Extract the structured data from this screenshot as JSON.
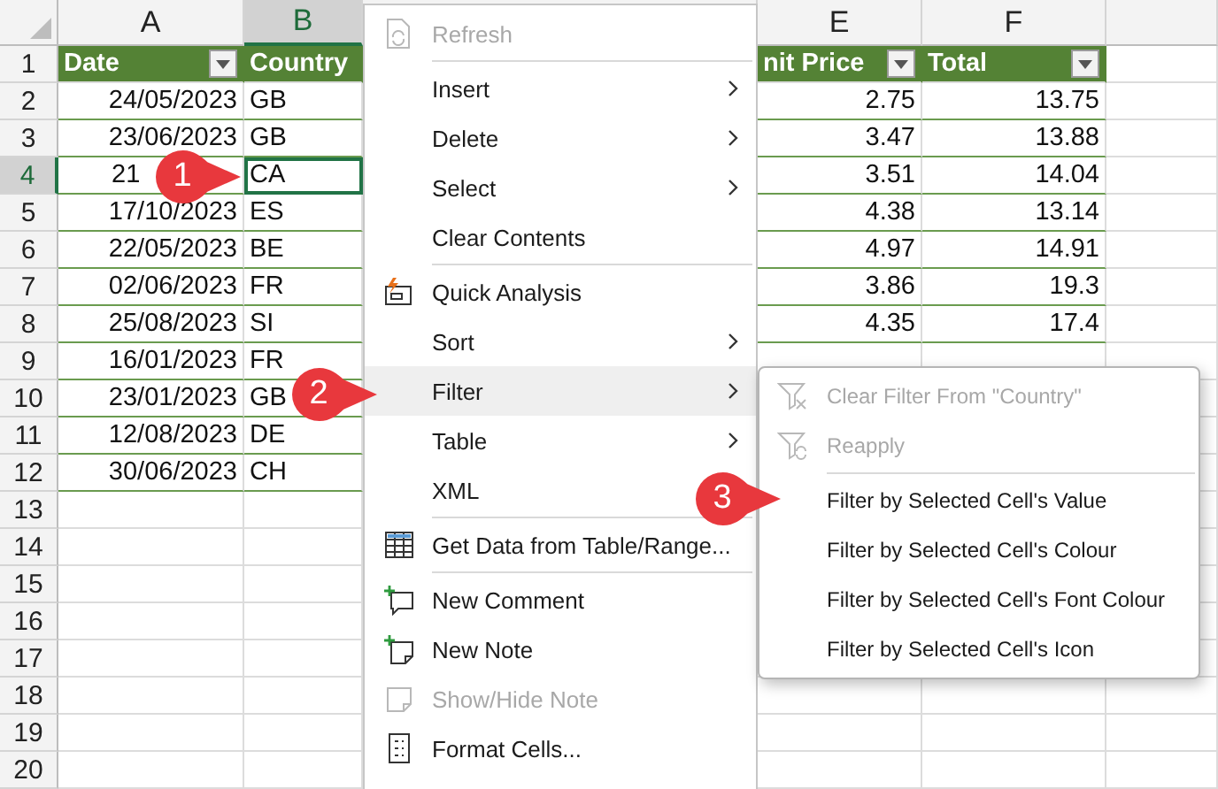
{
  "columns": [
    {
      "letter": "A",
      "selected": false
    },
    {
      "letter": "B",
      "selected": true
    },
    {
      "letter": "E",
      "selected": false
    },
    {
      "letter": "F",
      "selected": false
    }
  ],
  "rows": [
    {
      "number": "1",
      "selected": false,
      "kind": "header",
      "cells": [
        {
          "text": "Date",
          "filter_button": true
        },
        {
          "text": "Country",
          "filter_button": false
        },
        {
          "text": "nit Price",
          "filter_button": true
        },
        {
          "text": "Total",
          "filter_button": true
        }
      ]
    },
    {
      "number": "2",
      "selected": false,
      "kind": "data",
      "cells": [
        {
          "text": "24/05/2023",
          "selected": false
        },
        {
          "text": "GB",
          "selected": false
        },
        {
          "text": "2.75",
          "selected": false
        },
        {
          "text": "13.75",
          "selected": false
        }
      ]
    },
    {
      "number": "3",
      "selected": false,
      "kind": "data",
      "cells": [
        {
          "text": "23/06/2023",
          "selected": false
        },
        {
          "text": "GB",
          "selected": false
        },
        {
          "text": "3.47",
          "selected": false
        },
        {
          "text": "13.88",
          "selected": false
        }
      ]
    },
    {
      "number": "4",
      "selected": true,
      "kind": "data",
      "cells": [
        {
          "text": "21",
          "selected": false,
          "cut": true
        },
        {
          "text": "CA",
          "selected": true
        },
        {
          "text": "3.51",
          "selected": false
        },
        {
          "text": "14.04",
          "selected": false
        }
      ]
    },
    {
      "number": "5",
      "selected": false,
      "kind": "data",
      "cells": [
        {
          "text": "17/10/2023",
          "selected": false
        },
        {
          "text": "ES",
          "selected": false
        },
        {
          "text": "4.38",
          "selected": false
        },
        {
          "text": "13.14",
          "selected": false
        }
      ]
    },
    {
      "number": "6",
      "selected": false,
      "kind": "data",
      "cells": [
        {
          "text": "22/05/2023",
          "selected": false
        },
        {
          "text": "BE",
          "selected": false
        },
        {
          "text": "4.97",
          "selected": false
        },
        {
          "text": "14.91",
          "selected": false
        }
      ]
    },
    {
      "number": "7",
      "selected": false,
      "kind": "data",
      "cells": [
        {
          "text": "02/06/2023",
          "selected": false
        },
        {
          "text": "FR",
          "selected": false
        },
        {
          "text": "3.86",
          "selected": false
        },
        {
          "text": "19.3",
          "selected": false
        }
      ]
    },
    {
      "number": "8",
      "selected": false,
      "kind": "data",
      "cells": [
        {
          "text": "25/08/2023",
          "selected": false
        },
        {
          "text": "SI",
          "selected": false
        },
        {
          "text": "4.35",
          "selected": false
        },
        {
          "text": "17.4",
          "selected": false
        }
      ]
    },
    {
      "number": "9",
      "selected": false,
      "kind": "data",
      "cells": [
        {
          "text": "16/01/2023",
          "selected": false
        },
        {
          "text": "FR",
          "selected": false
        }
      ]
    },
    {
      "number": "10",
      "selected": false,
      "kind": "data",
      "cells": [
        {
          "text": "23/01/2023",
          "selected": false
        },
        {
          "text": "GB",
          "selected": false
        }
      ]
    },
    {
      "number": "11",
      "selected": false,
      "kind": "data",
      "cells": [
        {
          "text": "12/08/2023",
          "selected": false
        },
        {
          "text": "DE",
          "selected": false
        }
      ]
    },
    {
      "number": "12",
      "selected": false,
      "kind": "data",
      "cells": [
        {
          "text": "30/06/2023",
          "selected": false
        },
        {
          "text": "CH",
          "selected": false
        }
      ]
    },
    {
      "number": "13",
      "selected": false,
      "kind": "empty"
    },
    {
      "number": "14",
      "selected": false,
      "kind": "empty"
    },
    {
      "number": "15",
      "selected": false,
      "kind": "empty"
    },
    {
      "number": "16",
      "selected": false,
      "kind": "empty"
    },
    {
      "number": "17",
      "selected": false,
      "kind": "empty"
    },
    {
      "number": "18",
      "selected": false,
      "kind": "empty"
    },
    {
      "number": "19",
      "selected": false,
      "kind": "empty"
    },
    {
      "number": "20",
      "selected": false,
      "kind": "empty"
    }
  ],
  "context_menu": {
    "items": [
      {
        "kind": "command",
        "label": "Refresh",
        "disabled": true,
        "selected": false
      },
      {
        "kind": "separator"
      },
      {
        "kind": "command",
        "label": "Insert",
        "disabled": false,
        "selected": false,
        "submenu": true
      },
      {
        "kind": "command",
        "label": "Delete",
        "disabled": false,
        "selected": false,
        "submenu": true
      },
      {
        "kind": "command",
        "label": "Select",
        "disabled": false,
        "selected": false,
        "submenu": true
      },
      {
        "kind": "command",
        "label": "Clear Contents",
        "disabled": false,
        "selected": false
      },
      {
        "kind": "separator"
      },
      {
        "kind": "command",
        "label": "Quick Analysis",
        "disabled": false,
        "selected": false
      },
      {
        "kind": "command",
        "label": "Sort",
        "disabled": false,
        "selected": false,
        "submenu": true
      },
      {
        "kind": "command",
        "label": "Filter",
        "disabled": false,
        "selected": true,
        "submenu": true
      },
      {
        "kind": "command",
        "label": "Table",
        "disabled": false,
        "selected": false,
        "submenu": true
      },
      {
        "kind": "command",
        "label": "XML",
        "disabled": false,
        "selected": false
      },
      {
        "kind": "separator"
      },
      {
        "kind": "command",
        "label": "Get Data from Table/Range...",
        "disabled": false,
        "selected": false
      },
      {
        "kind": "separator"
      },
      {
        "kind": "command",
        "label": "New Comment",
        "disabled": false,
        "selected": false
      },
      {
        "kind": "command",
        "label": "New Note",
        "disabled": false,
        "selected": false
      },
      {
        "kind": "command",
        "label": "Show/Hide Note",
        "disabled": true,
        "selected": false
      },
      {
        "kind": "command",
        "label": "Format Cells...",
        "disabled": false,
        "selected": false
      }
    ]
  },
  "filter_submenu": {
    "items": [
      {
        "kind": "command",
        "label": "Clear Filter From \"Country\"",
        "disabled": true,
        "selected": false
      },
      {
        "kind": "command",
        "label": "Reapply",
        "disabled": true,
        "selected": false
      },
      {
        "kind": "separator"
      },
      {
        "kind": "command",
        "label": "Filter by Selected Cell's Value",
        "disabled": false,
        "selected": false
      },
      {
        "kind": "command",
        "label": "Filter by Selected Cell's Colour",
        "disabled": false,
        "selected": false
      },
      {
        "kind": "command",
        "label": "Filter by Selected Cell's Font Colour",
        "disabled": false,
        "selected": false
      },
      {
        "kind": "command",
        "label": "Filter by Selected Cell's Icon",
        "disabled": false,
        "selected": false
      }
    ]
  },
  "callouts": [
    {
      "label": "1"
    },
    {
      "label": "2"
    },
    {
      "label": "3"
    }
  ]
}
